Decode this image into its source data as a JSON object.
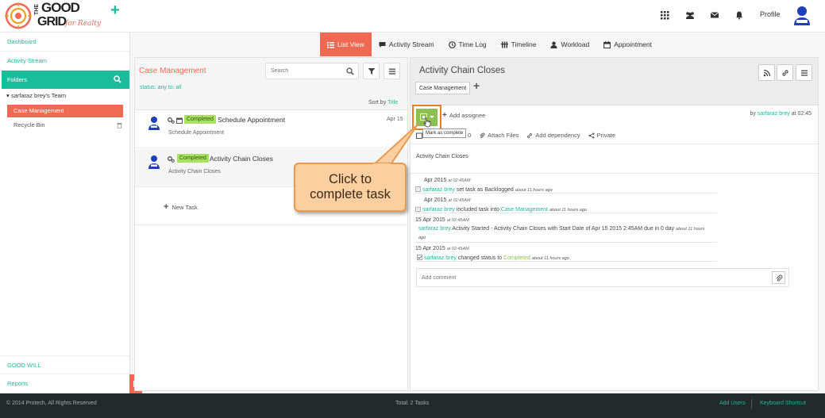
{
  "brand": {
    "logo_line1": "THE",
    "logo_line2": "GOOD",
    "logo_line3": "GRID",
    "logo_tagline": "for Realty",
    "accent": "#1abc9c",
    "primary": "#f06a53"
  },
  "header": {
    "icons": [
      "grid-icon",
      "users-icon",
      "envelope-icon",
      "bell-icon"
    ],
    "profile_label": "Profile"
  },
  "sidebar": {
    "dashboard": "Dashboard",
    "activity_stream": "Activity Stream",
    "folders": "Folders",
    "team": "sarfaraz brey's Team",
    "case_management": "Case Management",
    "recycle_bin": "Recycle Bin",
    "good_will": "GOOD WILL",
    "reports": "Reports"
  },
  "tabs": [
    {
      "label": "List View",
      "icon": "list-icon",
      "active": true
    },
    {
      "label": "Activity Stream",
      "icon": "comment-icon",
      "active": false
    },
    {
      "label": "Time Log",
      "icon": "clock-icon",
      "active": false
    },
    {
      "label": "Timeline",
      "icon": "timeline-icon",
      "active": false
    },
    {
      "label": "Workload",
      "icon": "user-icon",
      "active": false
    },
    {
      "label": "Appointment",
      "icon": "calendar-icon",
      "active": false
    }
  ],
  "list": {
    "title": "Case Management",
    "status_filter": "status: any   to: all",
    "search_placeholder": "Search",
    "sort_by_prefix": "Sort by",
    "sort_by_value": "Title",
    "new_task": "New Task",
    "tasks": [
      {
        "badge": "Completed",
        "title": "Schedule Appointment",
        "subtitle": "Schedule Appointment",
        "date": "Apr 15"
      },
      {
        "badge": "Completed",
        "title": "Activity Chain Closes",
        "subtitle": "Activity Chain Closes",
        "date": ""
      }
    ]
  },
  "detail": {
    "title": "Activity Chain Closes",
    "tag": "Case Management",
    "add_assignee": "Add assignee",
    "by_prefix": "by",
    "by_user": "sarfaraz brey",
    "by_time": "at 02:45",
    "tooltip": "Mark as complete",
    "actions": {
      "date_suffix": "0",
      "attach": "Attach Files",
      "dependency": "Add dependency",
      "private": "Private"
    },
    "description": "Activity Chain Closes",
    "activity": [
      {
        "date": "Apr 2015",
        "time": "at 02:45AM",
        "user": "sarfaraz brey",
        "text": "set task as Backlogged",
        "ago": "about 11 hours ago"
      },
      {
        "date": "Apr 2015",
        "time": "at 02:45AM",
        "user": "sarfaraz brey",
        "text": "included task into",
        "link": "Case Management",
        "ago": "about 11 hours ago"
      },
      {
        "date": "15 Apr 2015",
        "time": "at 02:45AM",
        "user": "sarfaraz brey",
        "text": "Activity Started - Activity Chain Closes with Start Date of Apr 15 2015 2:45AM due in 0 day",
        "ago": "about 11 hours",
        "ago2": "ago"
      },
      {
        "date": "15 Apr 2015",
        "time": "at 02:45AM",
        "user": "sarfaraz brey",
        "text": "changed status to",
        "status": "Completed",
        "ago": "about 11 hours ago"
      }
    ],
    "comment_placeholder": "Add comment"
  },
  "callout": {
    "line1": "Click to",
    "line2": "complete task"
  },
  "footer": {
    "copyright": "© 2014 Protech, All Rights Reserved",
    "total": "Total: 2 Tasks",
    "add_users": "Add Users",
    "shortcut": "Keyboard Shortcut"
  }
}
